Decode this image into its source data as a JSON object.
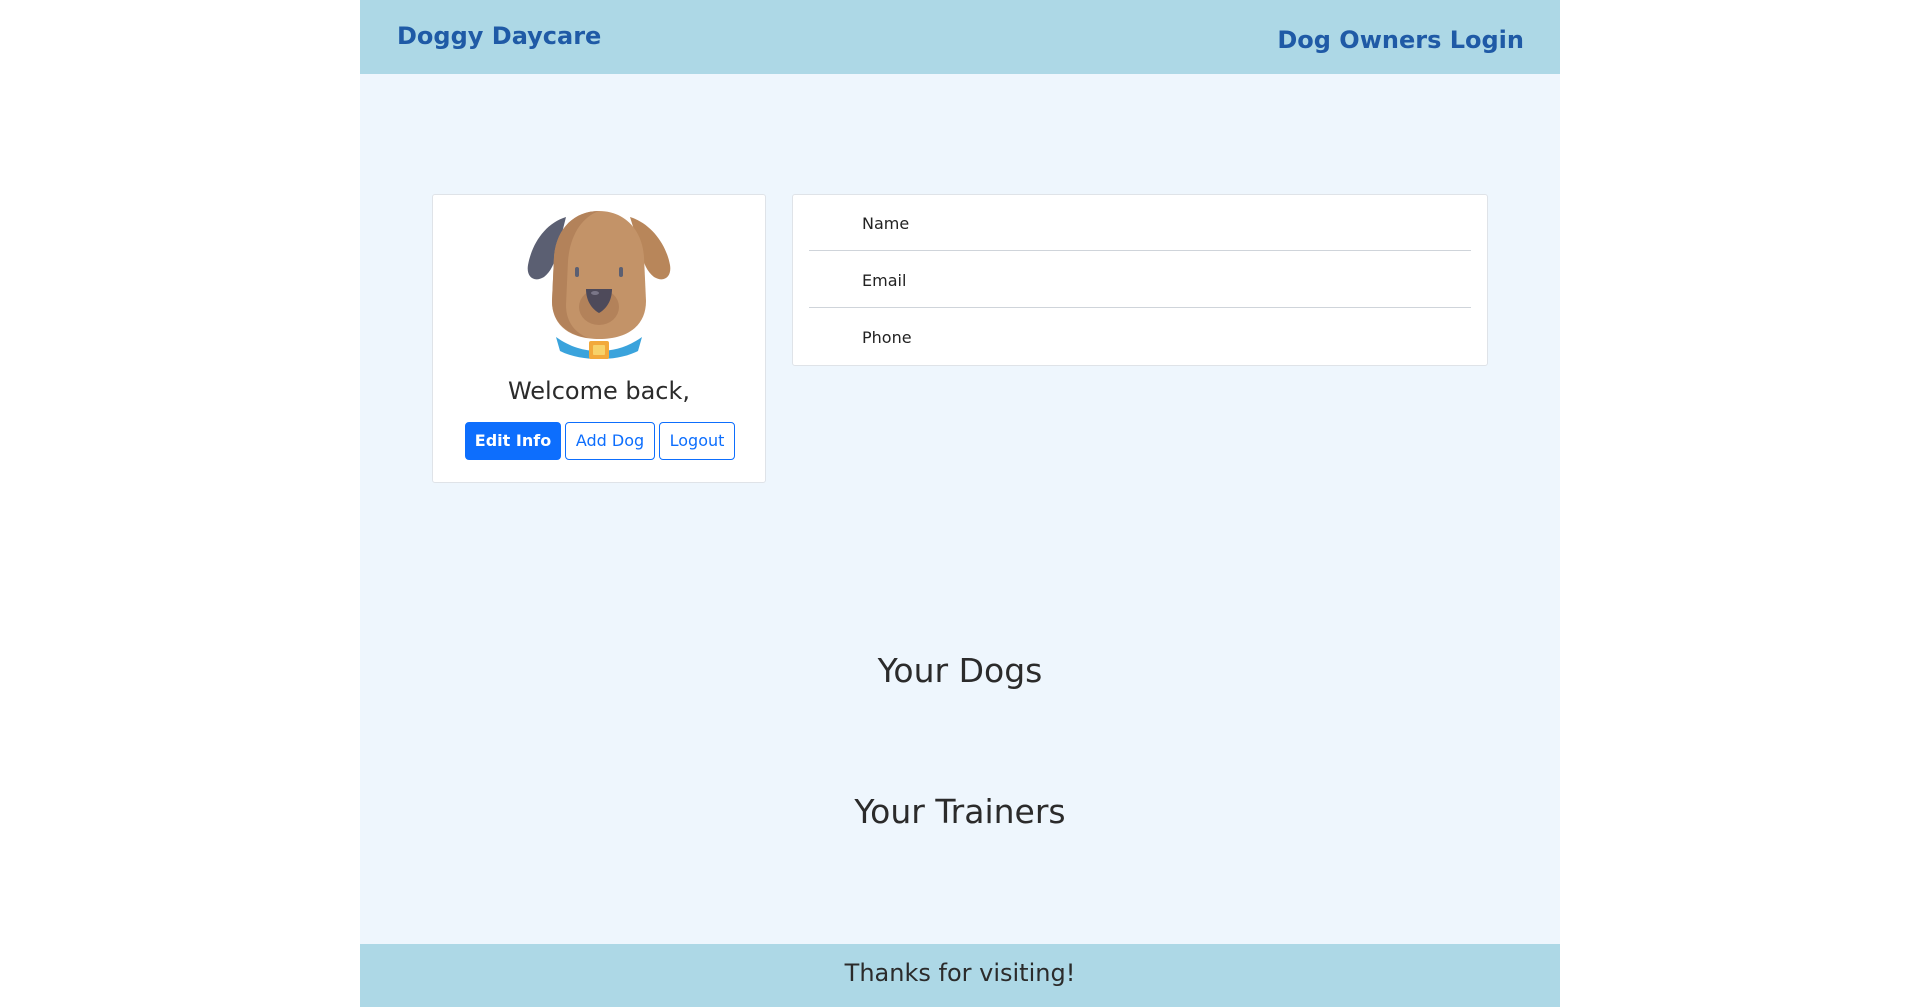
{
  "navbar": {
    "brand": "Doggy Daycare",
    "login_link": "Dog Owners Login"
  },
  "profile": {
    "avatar_icon": "dog-face-icon",
    "welcome_text": "Welcome back,",
    "buttons": {
      "edit_info": "Edit Info",
      "add_dog": "Add Dog",
      "logout": "Logout"
    }
  },
  "info": {
    "rows": [
      {
        "label": "Name"
      },
      {
        "label": "Email"
      },
      {
        "label": "Phone"
      }
    ]
  },
  "sections": {
    "dogs_title": "Your Dogs",
    "trainers_title": "Your Trainers"
  },
  "footer": {
    "text": "Thanks for visiting!"
  },
  "colors": {
    "navbar_bg": "#add8e6",
    "page_bg": "#eef6fd",
    "brand_text": "#1f5aa6",
    "primary": "#0d6efd"
  }
}
